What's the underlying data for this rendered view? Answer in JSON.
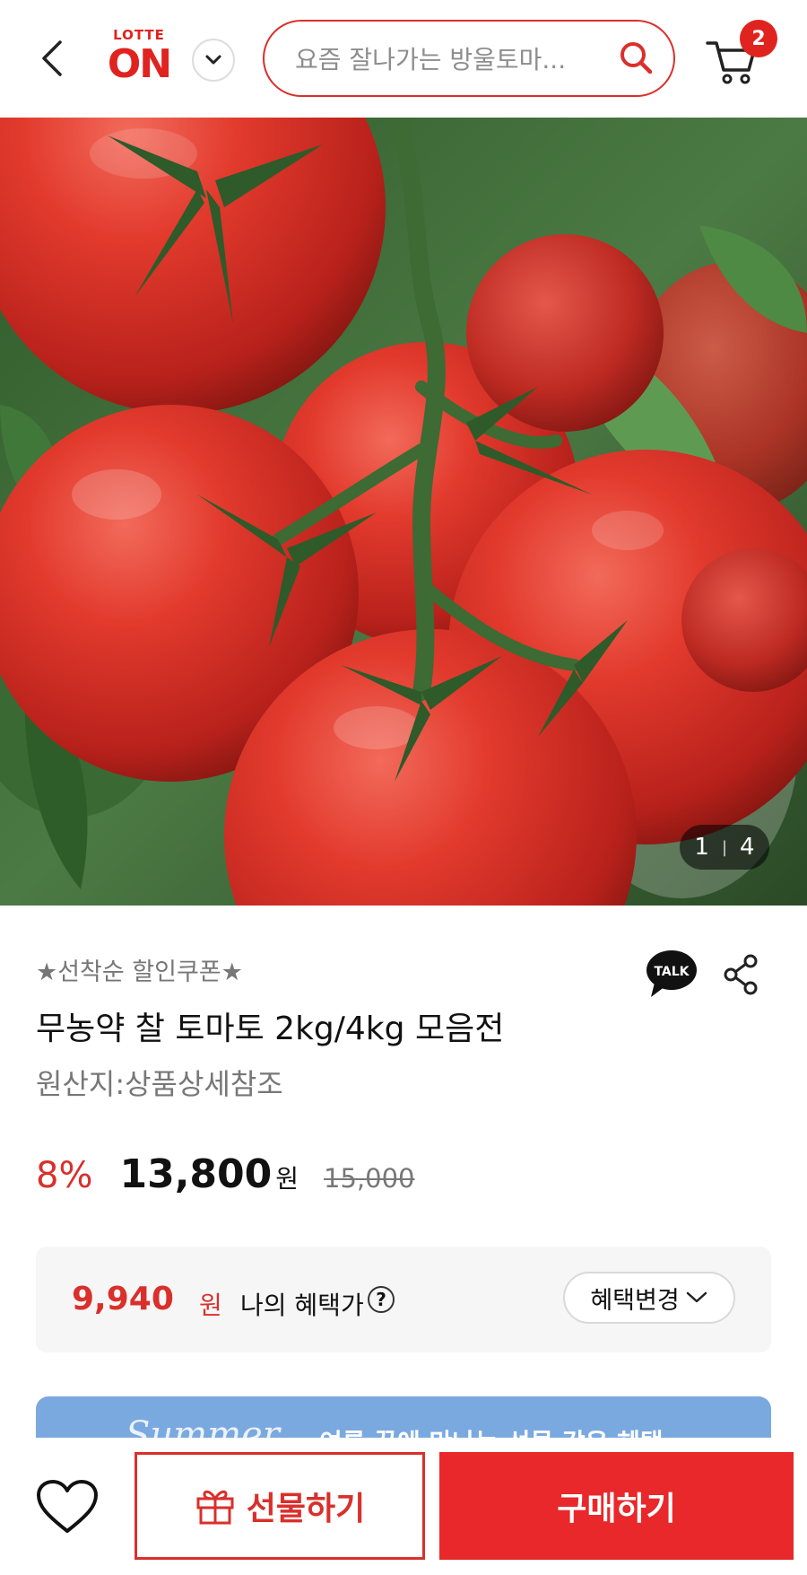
{
  "header": {
    "logo_top": "LOTTE",
    "logo_main": "ON",
    "search_placeholder": "요즘 잘나가는 방울토마...",
    "cart_count": "2",
    "icons": [
      "back-arrow-icon",
      "chevron-down-icon",
      "search-icon",
      "cart-icon"
    ],
    "accent_color": "#e0231f"
  },
  "gallery": {
    "current": "1",
    "total": "4"
  },
  "product": {
    "coupon_label": "★선착순 할인쿠폰★",
    "title": "무농약 찰 토마토 2kg/4kg 모음전",
    "origin": "원산지:상품상세참조",
    "talk_label": "TALK",
    "discount": "8%",
    "price": "13,800",
    "price_unit": "원",
    "original_price": "15,000"
  },
  "benefit": {
    "price": "9,940",
    "unit": "원",
    "label": "나의 혜택가",
    "help": "?",
    "change_label": "혜택변경"
  },
  "banner": {
    "script_text": "Summer",
    "text": "여름 끝에 만나는 선물 같은 혜택"
  },
  "bottom_bar": {
    "gift_label": "선물하기",
    "buy_label": "구매하기",
    "buy_color": "#e8282a"
  }
}
